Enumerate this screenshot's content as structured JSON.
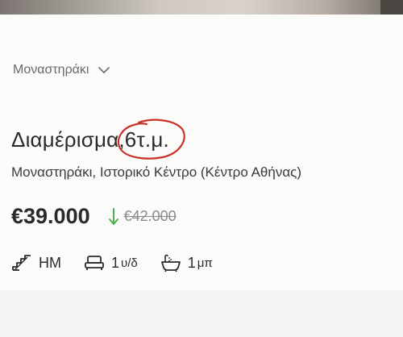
{
  "area_selector": {
    "label": "Μοναστηράκι",
    "icon": "chevron-down-icon"
  },
  "listing": {
    "title_prefix": "Διαμέρισμα,",
    "title_size": "6τ.μ.",
    "address": "Μοναστηράκι, Ιστορικό Κέντρο (Κέντρο Αθήνας)",
    "price": "€39.000",
    "old_price": "€42.000",
    "price_drop_icon": "arrow-down-icon",
    "features": {
      "floor": {
        "icon": "stairs-icon",
        "value": "HM"
      },
      "bedrooms": {
        "icon": "bed-icon",
        "value": "1",
        "unit": "υ/δ"
      },
      "bathrooms": {
        "icon": "bathtub-icon",
        "value": "1",
        "unit": "μπ"
      }
    }
  },
  "colors": {
    "accent_green": "#4caf50",
    "annotation_red": "#c8322a",
    "text_primary": "#2a2a2a",
    "text_muted": "#8a8a8a"
  }
}
